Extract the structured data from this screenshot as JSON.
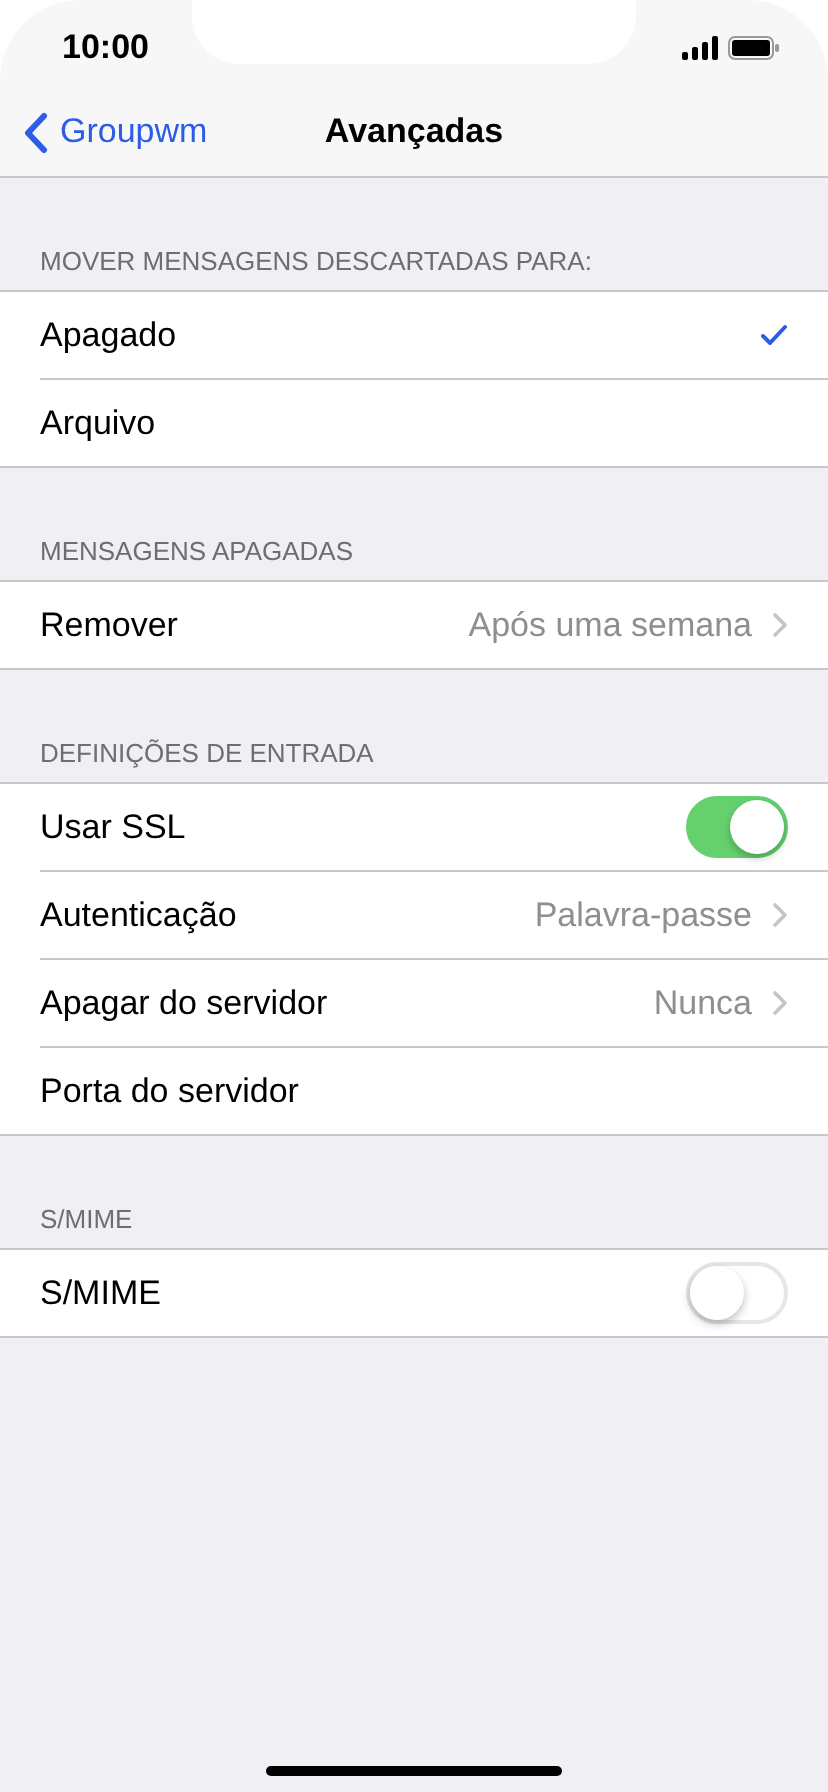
{
  "status_bar": {
    "time": "10:00"
  },
  "nav": {
    "back": "Groupwm",
    "title": "Avançadas"
  },
  "sections": [
    {
      "header": "MOVER MENSAGENS DESCARTADAS PARA:",
      "rows": [
        {
          "kind": "choice",
          "label": "Apagado",
          "selected": true
        },
        {
          "kind": "choice",
          "label": "Arquivo",
          "selected": false
        }
      ]
    },
    {
      "header": "MENSAGENS APAGADAS",
      "rows": [
        {
          "kind": "detail",
          "label": "Remover",
          "value": "Após uma semana"
        }
      ]
    },
    {
      "header": "DEFINIÇÕES DE ENTRADA",
      "rows": [
        {
          "kind": "toggle",
          "label": "Usar SSL",
          "on": true
        },
        {
          "kind": "detail",
          "label": "Autenticação",
          "value": "Palavra-passe"
        },
        {
          "kind": "detail",
          "label": "Apagar do servidor",
          "value": "Nunca"
        },
        {
          "kind": "plain",
          "label": "Porta do servidor"
        }
      ]
    },
    {
      "header": "S/MIME",
      "rows": [
        {
          "kind": "toggle",
          "label": "S/MIME",
          "on": false
        }
      ]
    }
  ]
}
